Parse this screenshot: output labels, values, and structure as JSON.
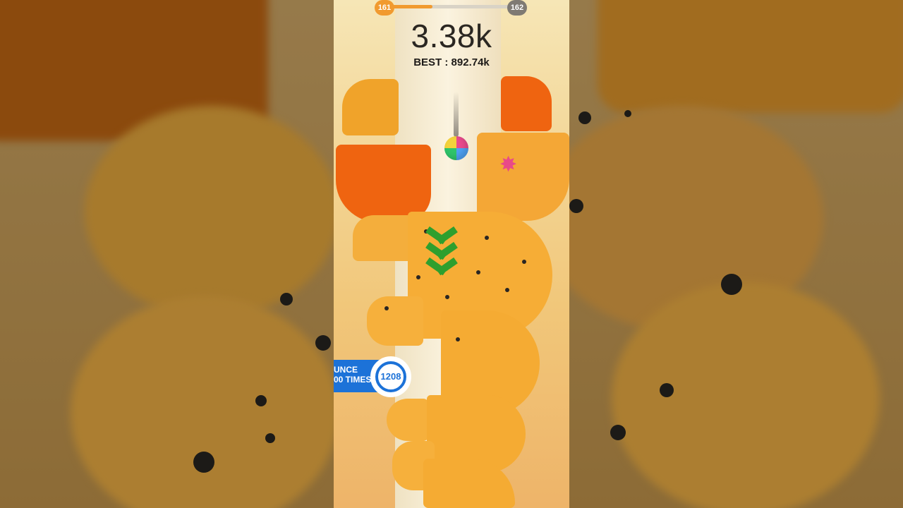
{
  "level": {
    "current": "161",
    "next": "162",
    "progress": 0.36
  },
  "score": {
    "value": "3.38k",
    "best_label": "BEST : 892.74k"
  },
  "challenge": {
    "line1": "UNCE",
    "line2": "00 TIMES",
    "counter": "1208"
  },
  "colors": {
    "platform": "#f5a623",
    "danger": "#ef6410",
    "arrow": "#2e9f2e",
    "accent_blue": "#1c72d8"
  },
  "icons": {
    "ball": "striped-ball-icon",
    "arrows": "chevron-down-icon",
    "splash": "paint-splash-icon"
  }
}
